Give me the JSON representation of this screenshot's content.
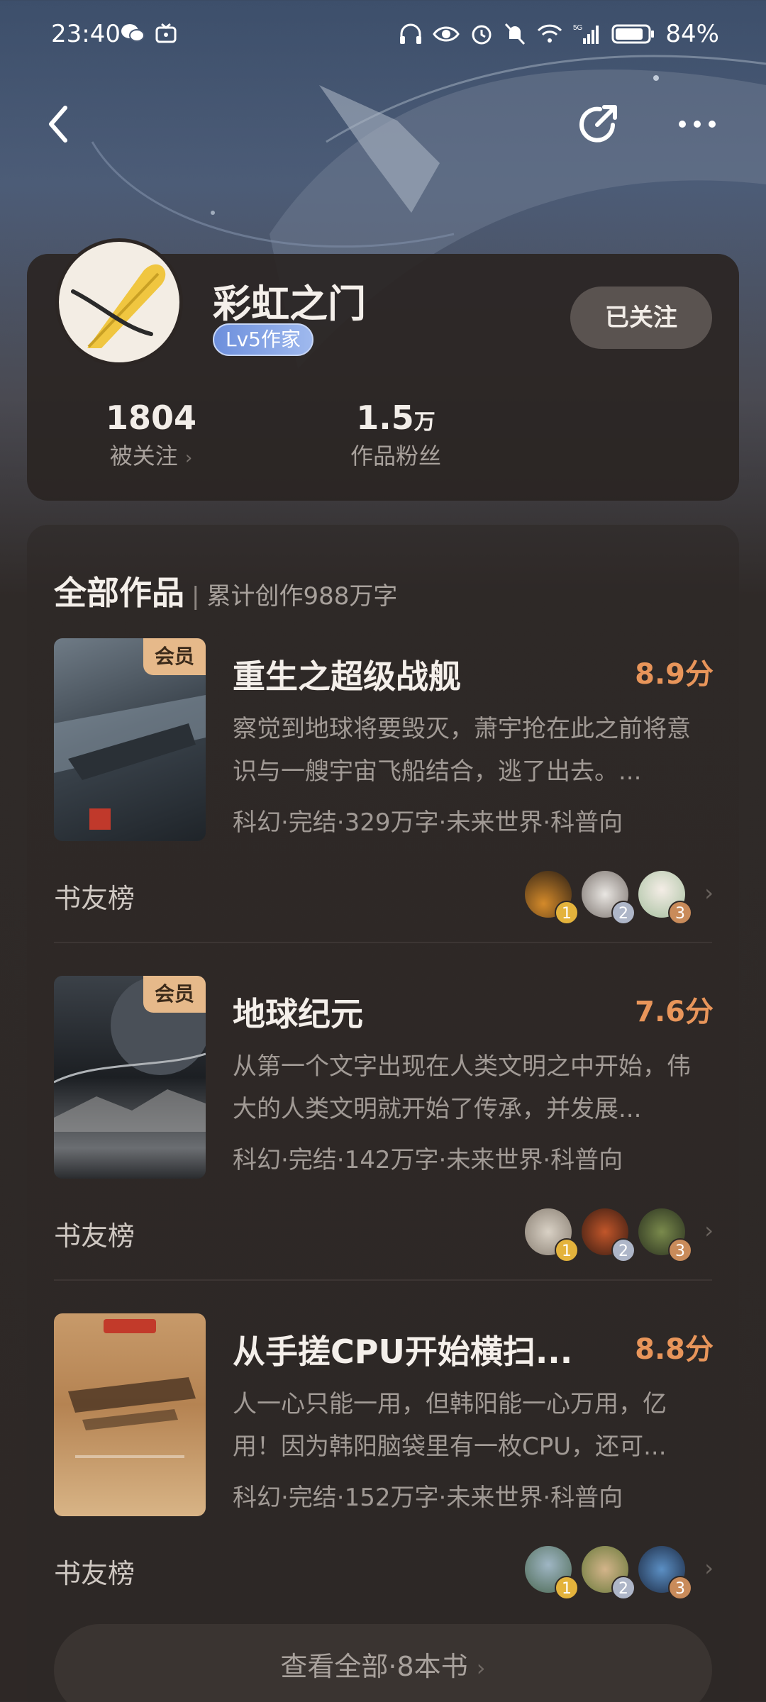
{
  "status_bar": {
    "time": "23:40",
    "battery_pct": "84%",
    "network": "5G"
  },
  "icons": {
    "back": "back-arrow-icon",
    "share": "share-icon",
    "more": "more-icon"
  },
  "author": {
    "name": "彩虹之门",
    "level": "Lv5作家",
    "follow_label": "已关注",
    "followers_value": "1804",
    "followers_label": "被关注",
    "fans_value": "1.5",
    "fans_unit": "万",
    "fans_label": "作品粉丝"
  },
  "works": {
    "title": "全部作品",
    "subtitle": "累计创作988万字",
    "vip_label": "会员",
    "fans_row_label": "书友榜",
    "books": [
      {
        "title": "重生之超级战舰",
        "score": "8.9分",
        "desc": "察觉到地球将要毁灭，萧宇抢在此之前将意识与一艘宇宙飞船结合，逃了出去。...",
        "meta": "科幻·完结·329万字·未来世界·科普向",
        "vip": true,
        "ranks": [
          "1",
          "2",
          "3"
        ]
      },
      {
        "title": "地球纪元",
        "score": "7.6分",
        "desc": "从第一个文字出现在人类文明之中开始，伟大的人类文明就开始了传承，并发展...",
        "meta": "科幻·完结·142万字·未来世界·科普向",
        "vip": true,
        "ranks": [
          "1",
          "2",
          "3"
        ]
      },
      {
        "title": "从手搓CPU开始横扫...",
        "score": "8.8分",
        "desc": "人一心只能一用，但韩阳能一心万用，亿用！因为韩阳脑袋里有一枚CPU，还可...",
        "meta": "科幻·完结·152万字·未来世界·科普向",
        "vip": false,
        "ranks": [
          "1",
          "2",
          "3"
        ]
      }
    ],
    "view_all": "查看全部·8本书"
  },
  "colors": {
    "score": "#e8955a",
    "vip_tag": "#e6b98a",
    "rank_gold": "#e4b33c",
    "rank_silver": "#aeb6c8",
    "rank_bronze": "#c98b5a"
  }
}
